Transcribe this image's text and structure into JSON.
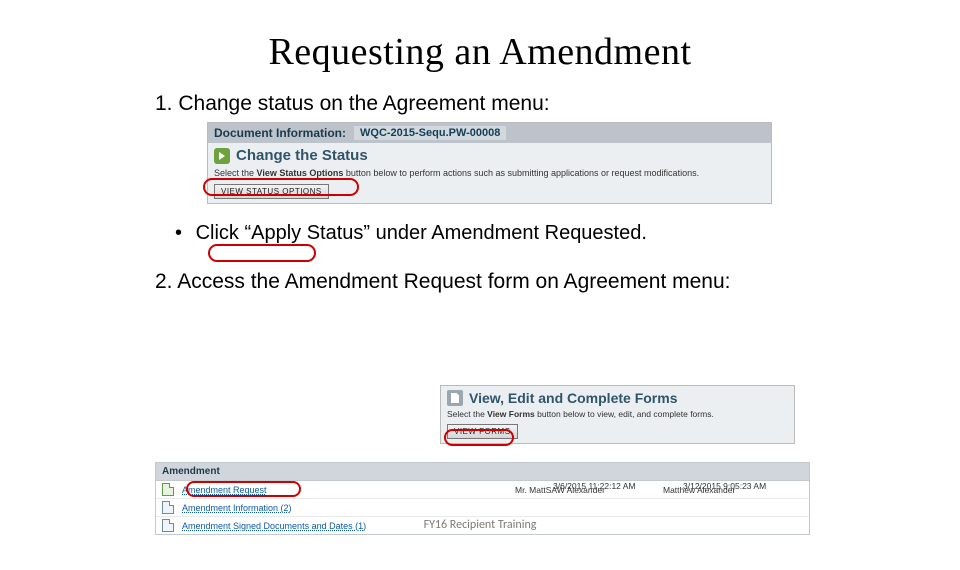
{
  "title": "Requesting an Amendment",
  "step1": "1.  Change status on the Agreement menu:",
  "docinfo": {
    "label": "Document Information:",
    "id": "WQC-2015-Sequ.PW-00008"
  },
  "change": {
    "title": "Change the Status",
    "desc_prefix": "Select the ",
    "desc_bold": "View Status Options",
    "desc_suffix": " button below to perform actions such as submitting applications or request modifications.",
    "button": "VIEW STATUS OPTIONS"
  },
  "bullet": "Click “Apply Status” under Amendment Requested.",
  "step2": "2.  Access the Amendment Request form on Agreement menu:",
  "forms": {
    "title": "View, Edit and Complete Forms",
    "desc_prefix": "Select the ",
    "desc_bold": "View Forms",
    "desc_suffix": " button below to view, edit, and complete forms.",
    "button": "VIEW FORMS"
  },
  "amend": {
    "header": "Amendment",
    "rows": [
      {
        "label": "Amendment Request",
        "user": "Mr. MattSAW Alexander",
        "u2": "Matthew Alexander",
        "d1": "3/6/2015 11:22:12 AM",
        "d2": "3/12/2015 9:05:23 AM"
      },
      {
        "label": "Amendment Information (2)"
      },
      {
        "label": "Amendment Signed Documents and Dates (1)"
      }
    ]
  },
  "footer": "FY16 Recipient Training"
}
